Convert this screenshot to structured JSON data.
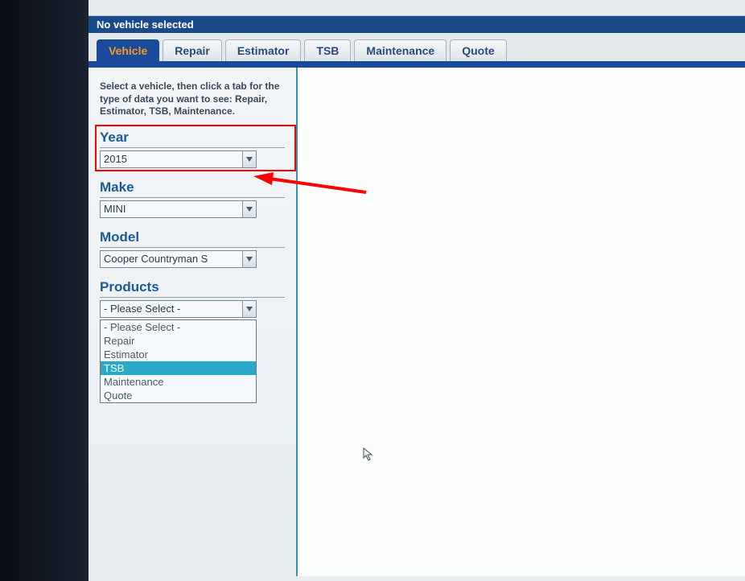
{
  "status": {
    "text": "No vehicle selected"
  },
  "tabs": [
    {
      "label": "Vehicle",
      "active": true
    },
    {
      "label": "Repair",
      "active": false
    },
    {
      "label": "Estimator",
      "active": false
    },
    {
      "label": "TSB",
      "active": false
    },
    {
      "label": "Maintenance",
      "active": false
    },
    {
      "label": "Quote",
      "active": false
    }
  ],
  "instruction": "Select a vehicle, then click a tab for the type of data you want to see: Repair, Estimator, TSB, Maintenance.",
  "fields": {
    "year": {
      "label": "Year",
      "value": "2015"
    },
    "make": {
      "label": "Make",
      "value": "MINI"
    },
    "model": {
      "label": "Model",
      "value": "Cooper Countryman S"
    },
    "products": {
      "label": "Products",
      "value": "- Please Select -"
    }
  },
  "products_options": [
    {
      "label": "- Please Select -",
      "highlighted": false
    },
    {
      "label": "Repair",
      "highlighted": false
    },
    {
      "label": "Estimator",
      "highlighted": false
    },
    {
      "label": "TSB",
      "highlighted": true
    },
    {
      "label": "Maintenance",
      "highlighted": false
    },
    {
      "label": "Quote",
      "highlighted": false
    }
  ],
  "colors": {
    "brand_blue": "#1a4a9a",
    "active_tab_text": "#f59a2e",
    "highlight_cyan": "#2aa8c8",
    "annotation_red": "#fe0000"
  }
}
